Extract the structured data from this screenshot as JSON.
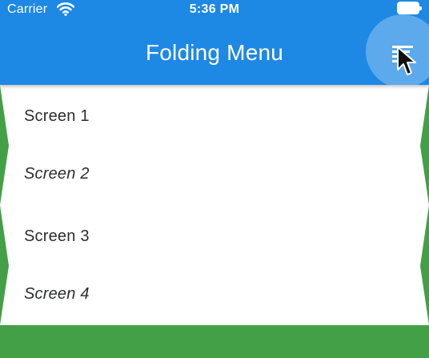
{
  "status_bar": {
    "carrier": "Carrier",
    "time": "5:36 PM"
  },
  "app_bar": {
    "title": "Folding Menu",
    "menu_icon": "menu-icon"
  },
  "menu": {
    "items": [
      {
        "label": "Screen 1"
      },
      {
        "label": "Screen 2"
      },
      {
        "label": "Screen 3"
      },
      {
        "label": "Screen 4"
      }
    ]
  },
  "colors": {
    "app_bar": "#1e88e5",
    "background": "#43a047",
    "menu_panel": "#ffffff",
    "menu_text": "#2b2f31"
  }
}
